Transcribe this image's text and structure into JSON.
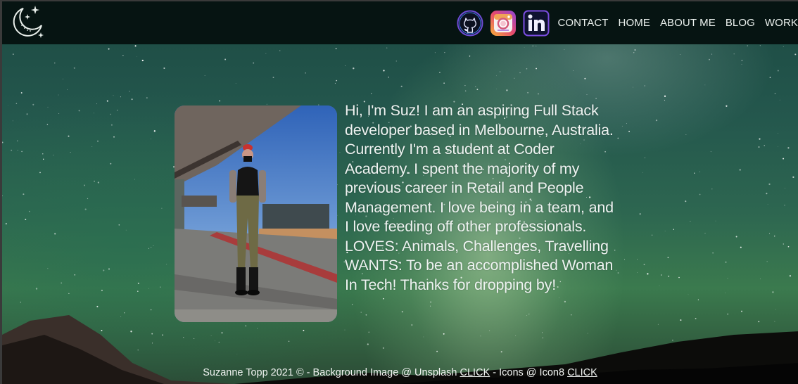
{
  "nav": {
    "logo_icon": "moon-stars-icon",
    "social": [
      {
        "name": "github-icon",
        "color": "#6d4cd6"
      },
      {
        "name": "instagram-icon",
        "color": "#e64a6d"
      },
      {
        "name": "linkedin-icon",
        "color": "#7b4de0"
      }
    ],
    "links": [
      "CONTACT",
      "HOME",
      "ABOUT ME",
      "BLOG",
      "WORK"
    ],
    "background": "#061412"
  },
  "about": {
    "bio_lines": [
      "Hi, I'm Suz! I am an aspiring Full Stack",
      "developer based in Melbourne, Australia.",
      "Currently I'm a student at Coder",
      "Academy. I spent the majority of my",
      "previous career in Retail and People",
      "Management. I love being in a team, and",
      "I love feeding off other professionals.",
      "LOVES: Animals, Challenges, Travelling",
      "WANTS: To be an accomplished Woman",
      "In Tech! Thanks for dropping by!"
    ]
  },
  "footer": {
    "text_1": "Suzanne Topp 2021 © - Background Image @ Unsplash ",
    "link_1": "CLICK",
    "text_2": " - Icons @ Icon8 ",
    "link_2": "CLICK"
  }
}
